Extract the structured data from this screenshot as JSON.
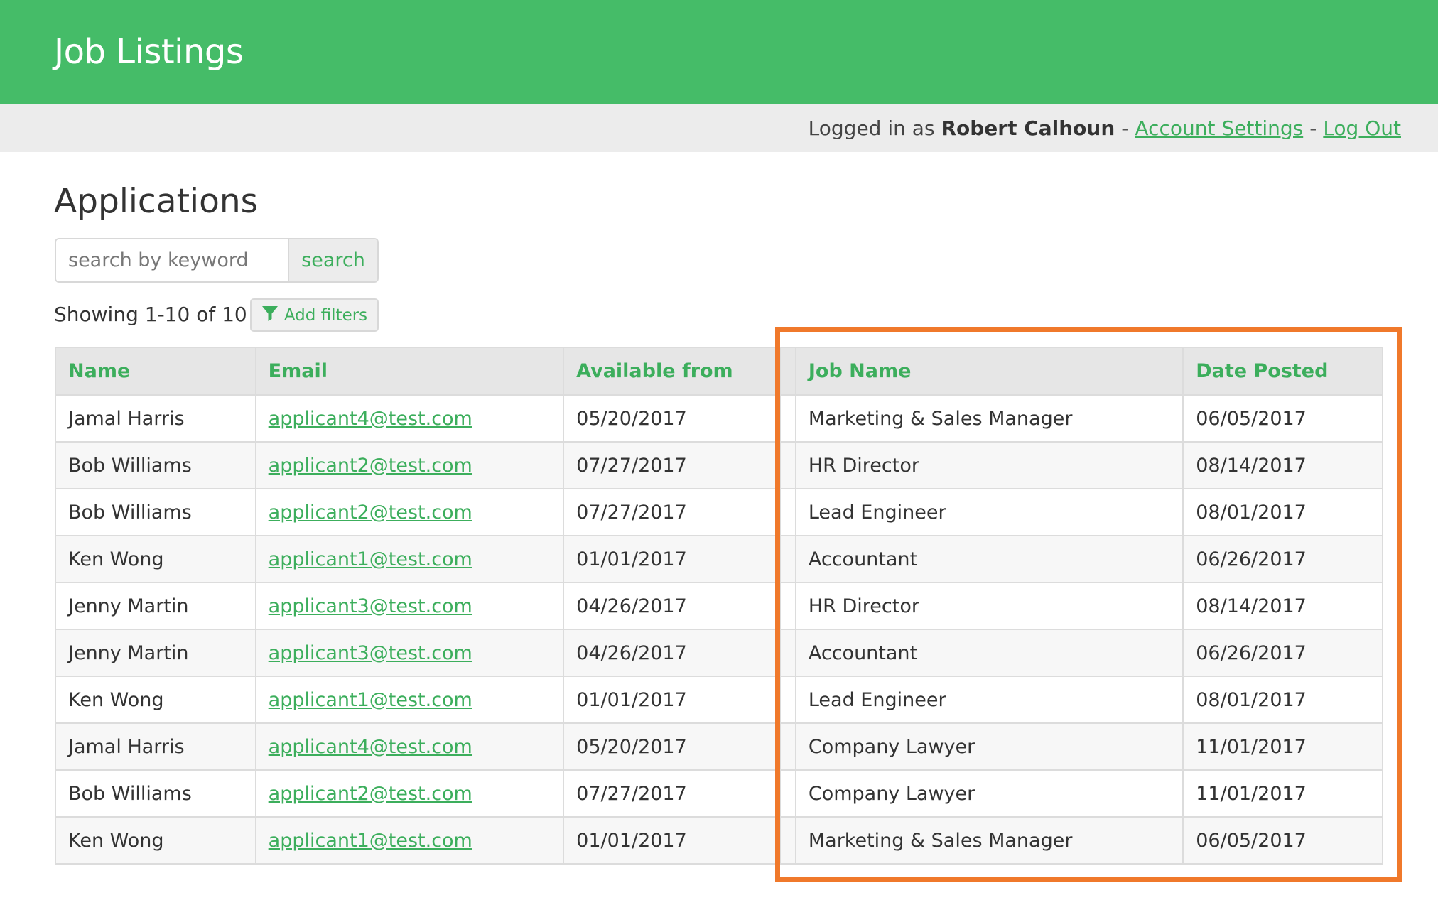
{
  "header": {
    "title": "Job Listings"
  },
  "user_bar": {
    "logged_in_prefix": "Logged in as",
    "user_name": "Robert Calhoun",
    "separator": "-",
    "account_settings_label": "Account Settings",
    "logout_label": "Log Out"
  },
  "main": {
    "section_title": "Applications",
    "search": {
      "placeholder": "search by keyword",
      "value": "",
      "button_label": "search"
    },
    "results_count": "Showing 1-10 of 10",
    "filters_label": "Add filters",
    "table": {
      "columns": [
        "Name",
        "Email",
        "Available from",
        "Job Name",
        "Date Posted"
      ],
      "rows": [
        {
          "name": "Jamal Harris",
          "email": "applicant4@test.com",
          "available": "05/20/2017",
          "job": "Marketing & Sales Manager",
          "posted": "06/05/2017"
        },
        {
          "name": "Bob Williams",
          "email": "applicant2@test.com",
          "available": "07/27/2017",
          "job": "HR Director",
          "posted": "08/14/2017"
        },
        {
          "name": "Bob Williams",
          "email": "applicant2@test.com",
          "available": "07/27/2017",
          "job": "Lead Engineer",
          "posted": "08/01/2017"
        },
        {
          "name": "Ken Wong",
          "email": "applicant1@test.com",
          "available": "01/01/2017",
          "job": "Accountant",
          "posted": "06/26/2017"
        },
        {
          "name": "Jenny Martin",
          "email": "applicant3@test.com",
          "available": "04/26/2017",
          "job": "HR Director",
          "posted": "08/14/2017"
        },
        {
          "name": "Jenny Martin",
          "email": "applicant3@test.com",
          "available": "04/26/2017",
          "job": "Accountant",
          "posted": "06/26/2017"
        },
        {
          "name": "Ken Wong",
          "email": "applicant1@test.com",
          "available": "01/01/2017",
          "job": "Lead Engineer",
          "posted": "08/01/2017"
        },
        {
          "name": "Jamal Harris",
          "email": "applicant4@test.com",
          "available": "05/20/2017",
          "job": "Company Lawyer",
          "posted": "11/01/2017"
        },
        {
          "name": "Bob Williams",
          "email": "applicant2@test.com",
          "available": "07/27/2017",
          "job": "Company Lawyer",
          "posted": "11/01/2017"
        },
        {
          "name": "Ken Wong",
          "email": "applicant1@test.com",
          "available": "01/01/2017",
          "job": "Marketing & Sales Manager",
          "posted": "06/05/2017"
        }
      ]
    }
  },
  "icons": {
    "filter": "filter-icon"
  },
  "colors": {
    "brand_green": "#45bc68",
    "link_green": "#3cae5c",
    "highlight_orange": "#f0792b",
    "user_bar_bg": "#ececec",
    "table_header_bg": "#e6e6e6"
  }
}
